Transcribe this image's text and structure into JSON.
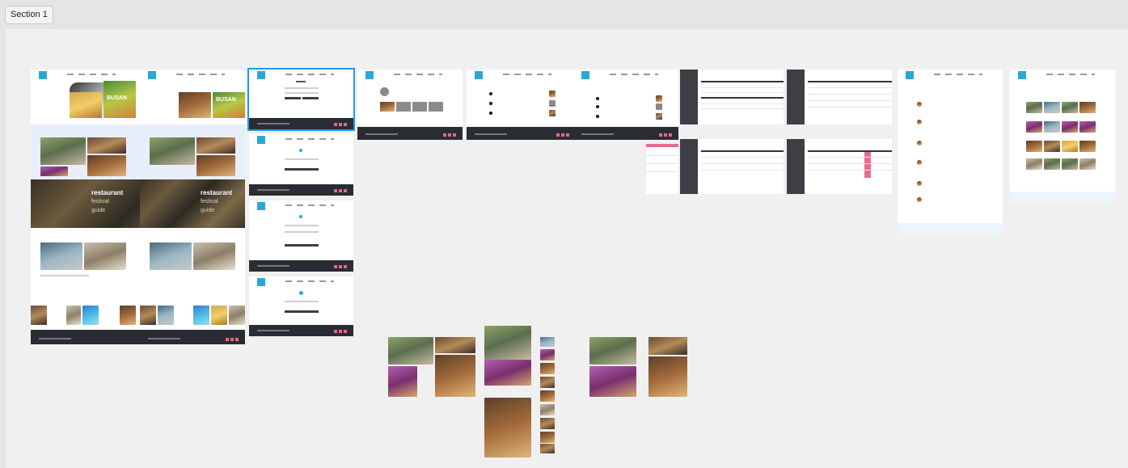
{
  "section": {
    "label": "Section 1"
  },
  "colors": {
    "selection": "#1e9be6",
    "canvas": "#f0f0f0",
    "footer": "#2a2c33",
    "accent": "#2aa7d8"
  },
  "frames": {
    "home": {
      "banner_title": "BUSAN",
      "restaurant": "restaurant",
      "festival": "festival",
      "guide": "guide"
    },
    "home_copy": {
      "banner_title": "BUSAN",
      "restaurant": "restaurant",
      "festival": "festival",
      "guide": "guide"
    }
  }
}
